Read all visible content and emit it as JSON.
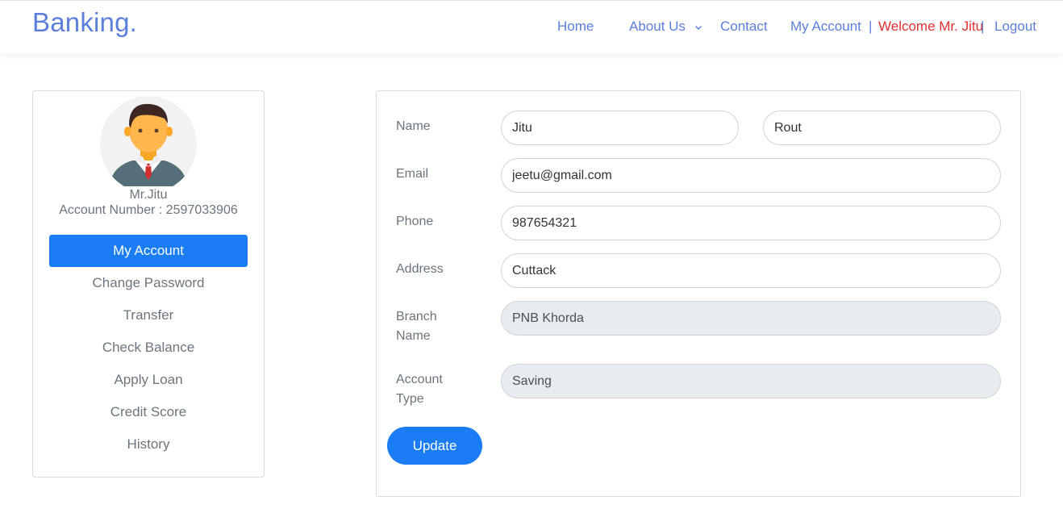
{
  "brand": "Banking.",
  "nav": {
    "home": "Home",
    "about": "About Us",
    "contact": "Contact",
    "my_account": "My Account",
    "sep1": "|",
    "welcome": "Welcome Mr. Jitu",
    "sep2": "|",
    "logout": "Logout"
  },
  "profile": {
    "name": "Mr.Jitu",
    "account_line": "Account Number : 2597033906"
  },
  "menu": [
    {
      "label": "My Account",
      "active": true
    },
    {
      "label": "Change Password"
    },
    {
      "label": "Transfer"
    },
    {
      "label": "Check Balance"
    },
    {
      "label": "Apply Loan"
    },
    {
      "label": "Credit Score"
    },
    {
      "label": "History"
    }
  ],
  "form": {
    "name_label": "Name",
    "first_name": "Jitu",
    "last_name": "Rout",
    "email_label": "Email",
    "email": "jeetu@gmail.com",
    "phone_label": "Phone",
    "phone": "987654321",
    "address_label": "Address",
    "address": "Cuttack",
    "branch_label_1": "Branch",
    "branch_label_2": "Name",
    "branch": "PNB Khorda",
    "acct_type_label_1": "Account",
    "acct_type_label_2": "Type",
    "account_type": "Saving",
    "update_label": "Update"
  },
  "colors": {
    "brand": "#5b7fdb",
    "primary": "#1a7df5",
    "welcome": "#e03131"
  }
}
